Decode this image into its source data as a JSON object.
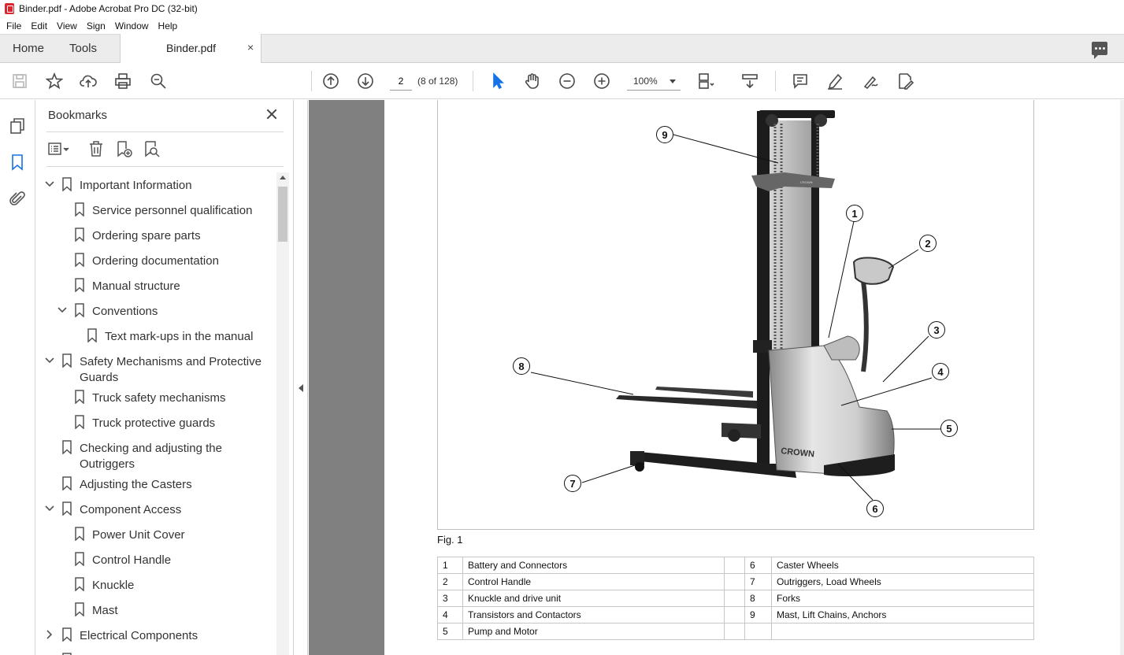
{
  "window": {
    "title": "Binder.pdf - Adobe Acrobat Pro DC (32-bit)"
  },
  "menu": [
    "File",
    "Edit",
    "View",
    "Sign",
    "Window",
    "Help"
  ],
  "tabs": {
    "home": "Home",
    "tools": "Tools",
    "document": "Binder.pdf",
    "close": "×"
  },
  "toolbar": {
    "page_number": "2",
    "page_count": "(8 of 128)",
    "zoom": "100%"
  },
  "bookmarks": {
    "title": "Bookmarks",
    "items": [
      {
        "label": "Important Information",
        "level": 0,
        "expanded": true
      },
      {
        "label": "Service personnel qualification",
        "level": 1
      },
      {
        "label": "Ordering spare parts",
        "level": 1
      },
      {
        "label": "Ordering documentation",
        "level": 1
      },
      {
        "label": "Manual structure",
        "level": 1
      },
      {
        "label": "Conventions",
        "level": 1,
        "expanded": true
      },
      {
        "label": "Text mark-ups in the manual",
        "level": 2
      },
      {
        "label": "Safety Mechanisms and Protective Guards",
        "level": 0,
        "expanded": true
      },
      {
        "label": "Truck safety mechanisms",
        "level": 1
      },
      {
        "label": "Truck protective guards",
        "level": 1
      },
      {
        "label": "Checking and adjusting the Outriggers",
        "level": 0
      },
      {
        "label": "Adjusting the Casters",
        "level": 0
      },
      {
        "label": "Component Access",
        "level": 0,
        "expanded": true
      },
      {
        "label": "Power Unit Cover",
        "level": 1
      },
      {
        "label": "Control Handle",
        "level": 1
      },
      {
        "label": "Knuckle",
        "level": 1
      },
      {
        "label": "Mast",
        "level": 1
      },
      {
        "label": "Electrical Components",
        "level": 0,
        "expanded": false
      }
    ]
  },
  "document": {
    "figure_caption": "Fig. 1",
    "callouts": [
      "1",
      "2",
      "3",
      "4",
      "5",
      "6",
      "7",
      "8",
      "9"
    ],
    "legend": [
      {
        "n1": "1",
        "t1": "Battery and Connectors",
        "n2": "6",
        "t2": "Caster Wheels"
      },
      {
        "n1": "2",
        "t1": "Control Handle",
        "n2": "7",
        "t2": "Outriggers, Load Wheels"
      },
      {
        "n1": "3",
        "t1": "Knuckle and drive unit",
        "n2": "8",
        "t2": "Forks"
      },
      {
        "n1": "4",
        "t1": "Transistors and Contactors",
        "n2": "9",
        "t2": "Mast, Lift Chains, Anchors"
      },
      {
        "n1": "5",
        "t1": "Pump and Motor",
        "n2": "",
        "t2": ""
      }
    ],
    "truck_brand": "CROWN",
    "mast_label": "CROWN"
  },
  "colors": {
    "accent": "#1473e6",
    "doc_bg": "#808080",
    "acrobat_red": "#d7282f"
  }
}
